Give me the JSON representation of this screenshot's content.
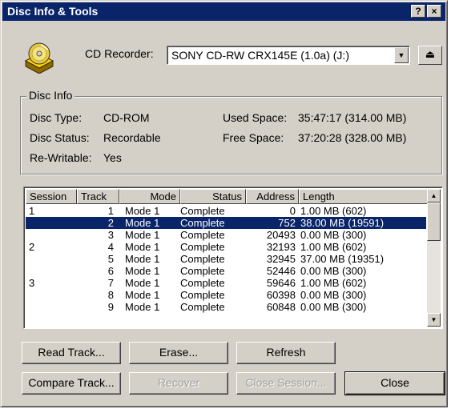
{
  "window": {
    "title": "Disc Info & Tools",
    "help_btn": "?",
    "close_btn": "×"
  },
  "recorder": {
    "label": "CD Recorder:",
    "value": "SONY CD-RW CRX145E (1.0a) (J:)",
    "arrow": "▼",
    "eject": "⏏"
  },
  "disc_info": {
    "group_title": "Disc Info",
    "type_label": "Disc Type:",
    "type_value": "CD-ROM",
    "status_label": "Disc Status:",
    "status_value": "Recordable",
    "rewritable_label": "Re-Writable:",
    "rewritable_value": "Yes",
    "used_label": "Used Space:",
    "used_value": "35:47:17 (314.00 MB)",
    "free_label": "Free Space:",
    "free_value": "37:20:28 (328.00 MB)"
  },
  "table": {
    "columns": [
      "Session",
      "Track",
      "Mode",
      "Status",
      "Address",
      "Length"
    ],
    "rows": [
      {
        "session": "1",
        "track": "1",
        "mode": "Mode 1",
        "status": "Complete",
        "address": "0",
        "length": "1.00 MB (602)"
      },
      {
        "session": "",
        "track": "2",
        "mode": "Mode 1",
        "status": "Complete",
        "address": "752",
        "length": "38.00 MB (19591)"
      },
      {
        "session": "",
        "track": "3",
        "mode": "Mode 1",
        "status": "Complete",
        "address": "20493",
        "length": "0.00 MB (300)"
      },
      {
        "session": "2",
        "track": "4",
        "mode": "Mode 1",
        "status": "Complete",
        "address": "32193",
        "length": "1.00 MB (602)"
      },
      {
        "session": "",
        "track": "5",
        "mode": "Mode 1",
        "status": "Complete",
        "address": "32945",
        "length": "37.00 MB (19351)"
      },
      {
        "session": "",
        "track": "6",
        "mode": "Mode 1",
        "status": "Complete",
        "address": "52446",
        "length": "0.00 MB (300)"
      },
      {
        "session": "3",
        "track": "7",
        "mode": "Mode 1",
        "status": "Complete",
        "address": "59646",
        "length": "1.00 MB (602)"
      },
      {
        "session": "",
        "track": "8",
        "mode": "Mode 1",
        "status": "Complete",
        "address": "60398",
        "length": "0.00 MB (300)"
      },
      {
        "session": "",
        "track": "9",
        "mode": "Mode 1",
        "status": "Complete",
        "address": "60848",
        "length": "0.00 MB (300)"
      }
    ],
    "scroll_up": "▲",
    "scroll_down": "▼"
  },
  "buttons": {
    "read_track": "Read Track...",
    "erase": "Erase...",
    "refresh": "Refresh",
    "compare_track": "Compare Track...",
    "recover": "Recover",
    "close_session": "Close Session...",
    "close": "Close"
  },
  "colors": {
    "face": "#d4d0c8",
    "title": "#0a246a",
    "selection": "#0a246a"
  }
}
